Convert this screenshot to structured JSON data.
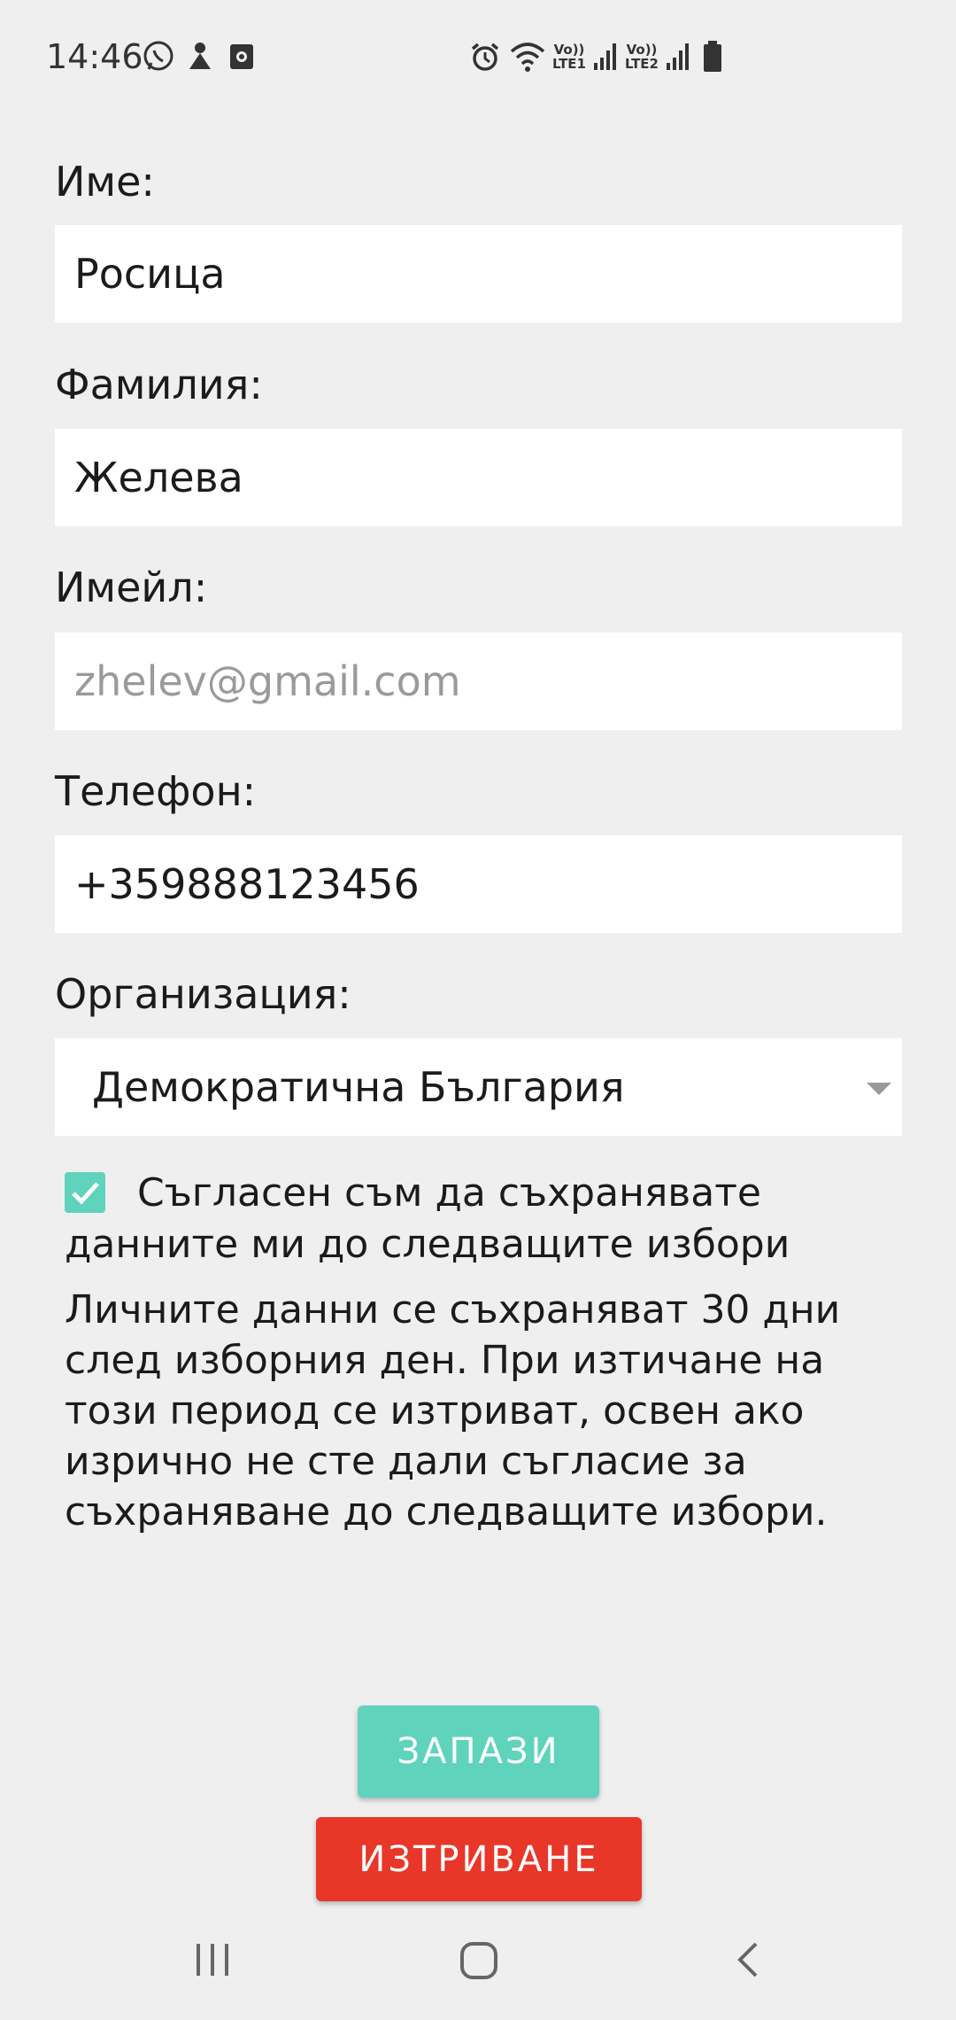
{
  "status_bar": {
    "time": "14:46",
    "icons": [
      "viber-icon",
      "notification-icon",
      "app-icon",
      "alarm-icon",
      "wifi-icon",
      "signal-icon",
      "battery-icon"
    ],
    "sim1_label_top": "Vo))",
    "sim1_label_bottom": "LTE1",
    "sim2_label_top": "Vo))",
    "sim2_label_bottom": "LTE2"
  },
  "form": {
    "first_name": {
      "label": "Име:",
      "value": "Росица"
    },
    "last_name": {
      "label": "Фамилия:",
      "value": "Желева"
    },
    "email": {
      "label": "Имейл:",
      "value": "",
      "placeholder": "zhelev@gmail.com"
    },
    "phone": {
      "label": "Телефон:",
      "value": "+359888123456"
    },
    "organization": {
      "label": "Организация:",
      "selected": "Демократична България"
    }
  },
  "consent": {
    "checked": true,
    "text": "Съгласен съм да съхранявате данните ми до следващите избори"
  },
  "info_text": "Личните данни се съхраняват 30 дни след изборния ден. При изтичане на този период се изтриват, освен ако изрично не сте дали съгласие за съхраняване до следващите избори.",
  "buttons": {
    "save": "ЗАПАЗИ",
    "delete": "ИЗТРИВАНЕ"
  },
  "colors": {
    "accent": "#5fd3bc",
    "danger": "#e83628",
    "background": "#efefef"
  },
  "nav_bar": {
    "icons": [
      "recent-apps-icon",
      "home-icon",
      "back-icon"
    ]
  }
}
